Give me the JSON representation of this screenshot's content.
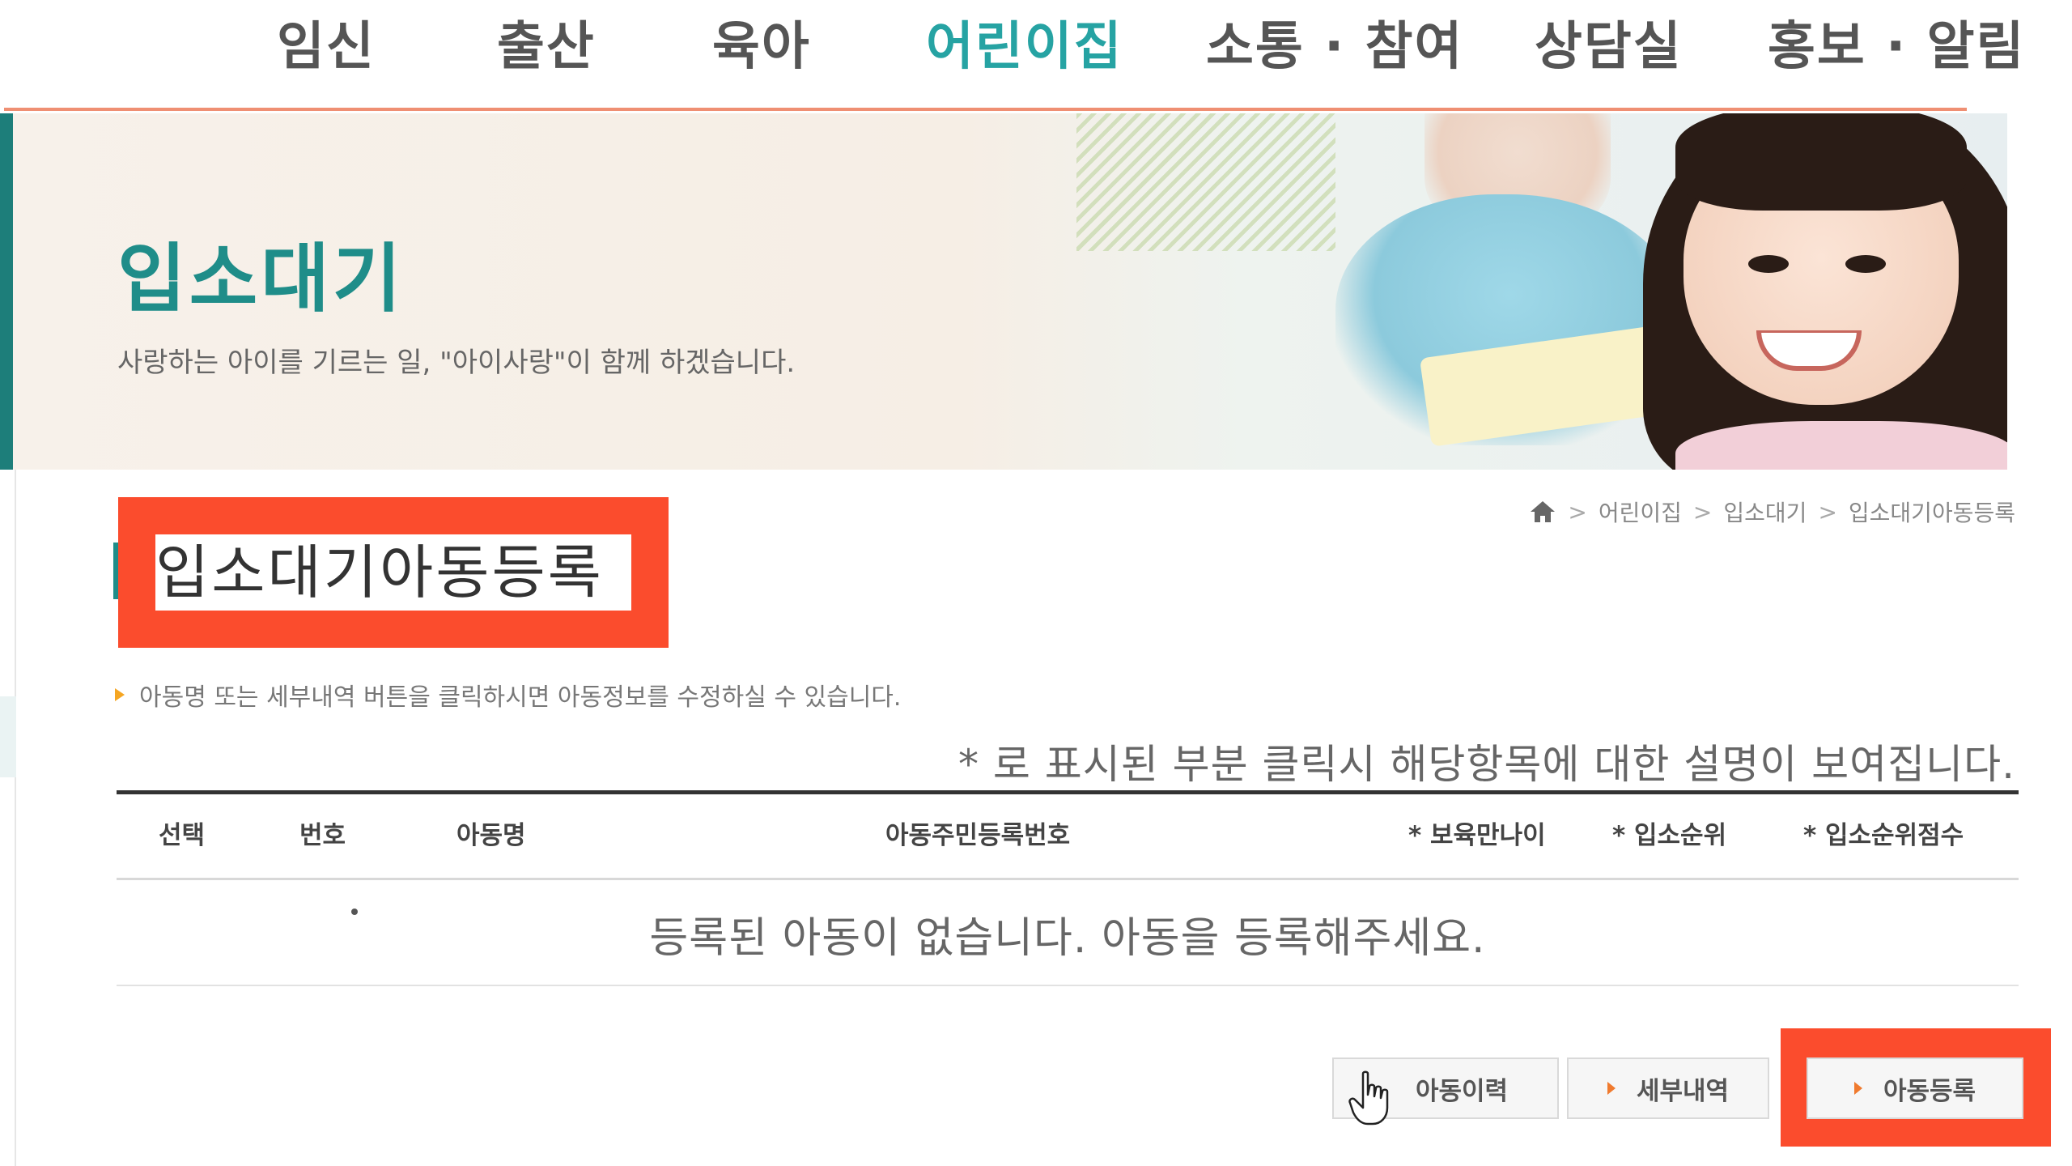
{
  "nav": {
    "items": [
      {
        "label": "임신"
      },
      {
        "label": "출산"
      },
      {
        "label": "육아"
      },
      {
        "label": "어린이집",
        "active": true
      },
      {
        "label": "소통 · 참여"
      },
      {
        "label": "상담실"
      },
      {
        "label": "홍보 · 알림"
      }
    ]
  },
  "hero": {
    "title": "입소대기",
    "subtitle": "사랑하는 아이를 기르는 일, \"아이사랑\"이 함께 하겠습니다."
  },
  "breadcrumb": {
    "home_icon": "home-icon",
    "items": [
      "어린이집",
      "입소대기",
      "입소대기아동등록"
    ]
  },
  "page": {
    "title": "입소대기아동등록",
    "note": "아동명 또는 세부내역 버튼을 클릭하시면 아동정보를 수정하실 수 있습니다.",
    "hint": "* 로 표시된 부분 클릭시 해당항목에 대한 설명이 보여집니다."
  },
  "table": {
    "columns": [
      "선택",
      "번호",
      "아동명",
      "아동주민등록번호",
      "* 보육만나이",
      "* 입소순위",
      "* 입소순위점수"
    ],
    "empty_message": "등록된 아동이 없습니다. 아동을 등록해주세요."
  },
  "buttons": {
    "history": "아동이력",
    "details": "세부내역",
    "register": "아동등록"
  },
  "colors": {
    "accent_teal": "#26a3a3",
    "highlight_red": "#fb4c2d",
    "nav_underline": "#ef8f73"
  }
}
